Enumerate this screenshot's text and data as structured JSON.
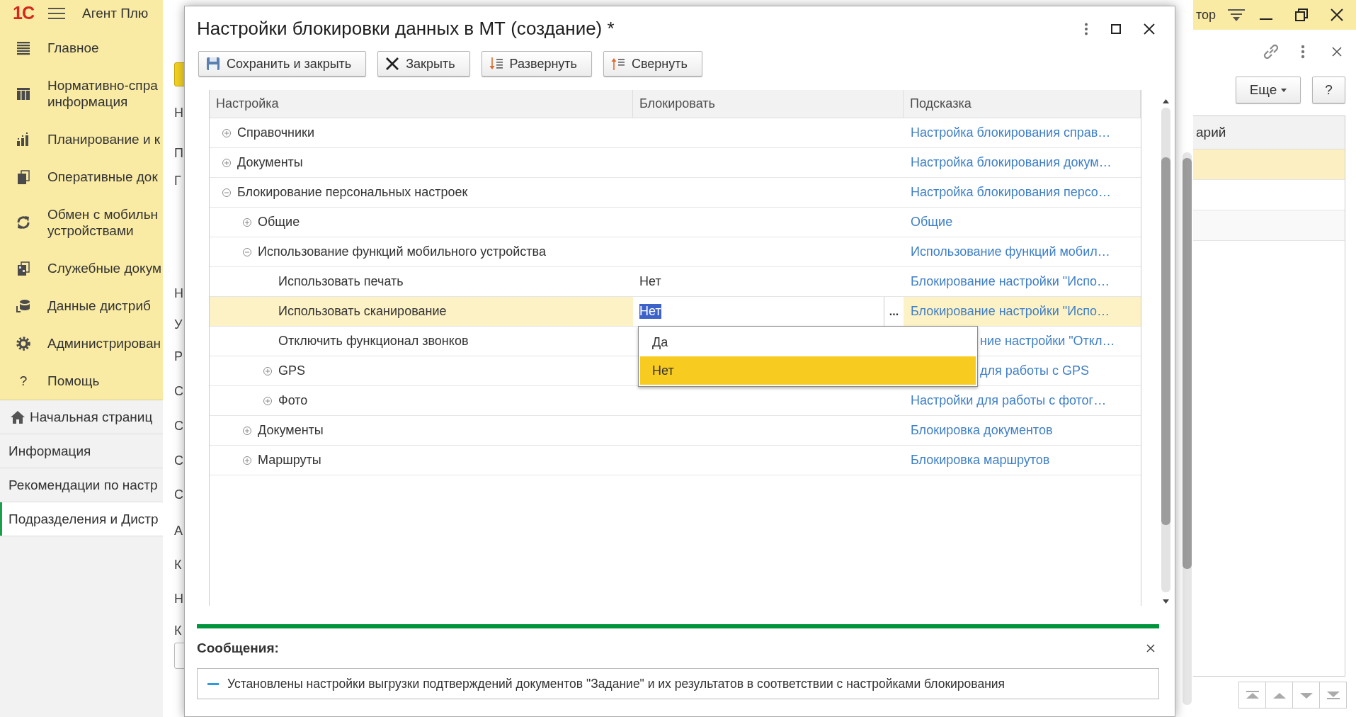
{
  "sidebar": {
    "logo": "1С",
    "app_title": "Агент Плю",
    "sections": [
      {
        "label": "Главное"
      },
      {
        "label": "Нормативно-спра\nинформация"
      },
      {
        "label": "Планирование и к"
      },
      {
        "label": "Оперативные док"
      },
      {
        "label": "Обмен с мобильн\nустройствами"
      },
      {
        "label": "Служебные докум"
      },
      {
        "label": "Данные дистриб"
      },
      {
        "label": "Администрирован"
      },
      {
        "label": "Помощь",
        "glyph": "?"
      }
    ],
    "nav": [
      {
        "label": "Начальная страниц",
        "selected": false
      },
      {
        "label": "Информация",
        "selected": false
      },
      {
        "label": "Рекомендации по настр",
        "selected": false
      },
      {
        "label": "Подразделения и Дистр",
        "selected": true
      }
    ]
  },
  "background_form": {
    "labels": [
      "Н",
      "П",
      "Г",
      "Н",
      "У",
      "Р",
      "С",
      "С",
      "С",
      "С",
      "А",
      "К",
      "Н",
      "К"
    ]
  },
  "dialog": {
    "title": "Настройки блокировки данных в МТ (создание) *",
    "toolbar": [
      "Сохранить и закрыть",
      "Закрыть",
      "Развернуть",
      "Свернуть"
    ],
    "table": {
      "columns": [
        "Настройка",
        "Блокировать",
        "Подсказка"
      ],
      "edit_button": "...",
      "rows": [
        {
          "label": "Справочники",
          "expanded": false,
          "hint": "Настройка блокирования справ…",
          "selected": false
        },
        {
          "label": "Документы",
          "expanded": false,
          "hint": "Настройка блокирования докум…",
          "selected": false
        },
        {
          "label": "Блокирование персональных настроек",
          "expanded": true,
          "hint": "Настройка блокирования персо…",
          "selected": false,
          "children": [
            {
              "label": "Общие",
              "expanded": false,
              "hint": "Общие",
              "selected": false
            },
            {
              "label": "Использование функций мобильного устройства",
              "expanded": true,
              "hint": "Использование функций мобил…",
              "selected": false,
              "children": [
                {
                  "label": "Использовать печать",
                  "value": "Нет",
                  "hint": "Блокирование настройки \"Испо…",
                  "selected": false
                },
                {
                  "label": "Использовать сканирование",
                  "value": "Нет",
                  "hint": "Блокирование настройки \"Испо…",
                  "selected": true
                },
                {
                  "label": "Отключить функционал звонков",
                  "hint": "ние настройки \"Откл…",
                  "selected": false
                },
                {
                  "label": "GPS",
                  "expanded": false,
                  "hint": "для работы с GPS",
                  "selected": false
                },
                {
                  "label": "Фото",
                  "expanded": false,
                  "hint": "Настройки для работы с фотог…",
                  "selected": false
                }
              ]
            },
            {
              "label": "Документы",
              "expanded": false,
              "hint": "Блокировка документов",
              "selected": false
            },
            {
              "label": "Маршруты",
              "expanded": false,
              "hint": "Блокировка маршрутов",
              "selected": false
            }
          ]
        }
      ]
    },
    "dropdown": {
      "options": [
        {
          "label": "Да",
          "selected": false
        },
        {
          "label": "Нет",
          "selected": true
        }
      ]
    },
    "messages": {
      "title": "Сообщения:",
      "items": [
        "Установлены настройки выгрузки подтверждений документов \"Задание\" и их результатов в соответствии с настройками блокирования"
      ]
    }
  },
  "right_panel": {
    "title": "тор",
    "more_button": "Еще",
    "help_button": "?",
    "table": {
      "columns": [
        "арий"
      ],
      "rows": [
        {
          "selected": true
        },
        {
          "selected": false
        },
        {
          "selected": false
        }
      ]
    }
  }
}
